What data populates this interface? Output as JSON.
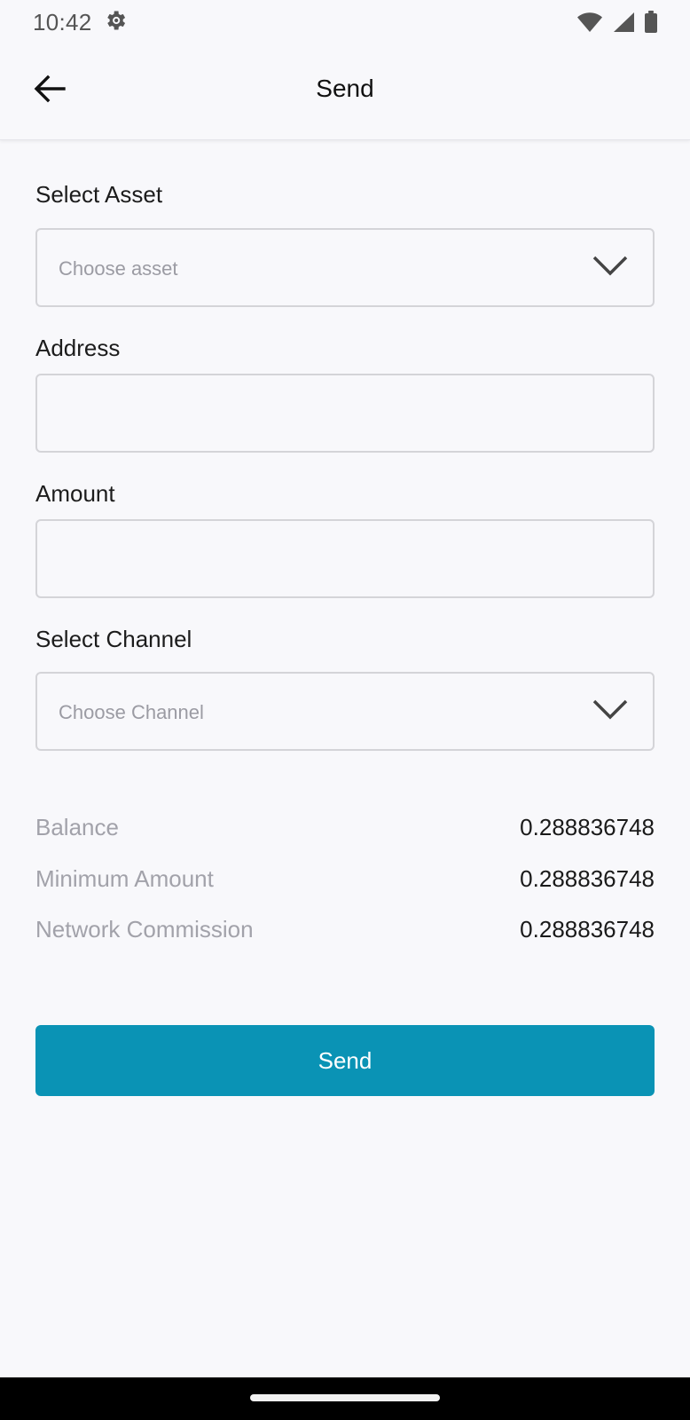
{
  "status_bar": {
    "time": "10:42",
    "icons": [
      "settings-icon",
      "wifi-icon",
      "signal-icon",
      "battery-icon"
    ]
  },
  "app_bar": {
    "title": "Send",
    "back_icon": "arrow-left-icon"
  },
  "form": {
    "asset": {
      "label": "Select Asset",
      "placeholder": "Choose asset",
      "value": ""
    },
    "address": {
      "label": "Address",
      "value": ""
    },
    "amount": {
      "label": "Amount",
      "value": ""
    },
    "channel": {
      "label": "Select Channel",
      "placeholder": "Choose Channel",
      "value": ""
    }
  },
  "summary": [
    {
      "label": "Balance",
      "value": "0.288836748"
    },
    {
      "label": "Minimum Amount",
      "value": "0.288836748"
    },
    {
      "label": "Network Commission",
      "value": "0.288836748"
    }
  ],
  "send_button": {
    "label": "Send"
  },
  "colors": {
    "accent": "#0a93b5",
    "background": "#f8f8fb",
    "muted_text": "#a2a2aa",
    "border": "#d4d4d8"
  }
}
